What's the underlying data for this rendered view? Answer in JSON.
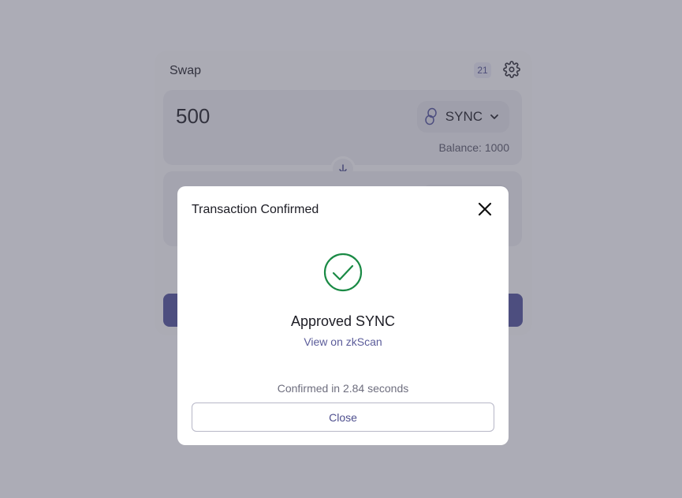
{
  "swap": {
    "title": "Swap",
    "pending_count": "21",
    "from": {
      "amount": "500",
      "token": "SYNC",
      "balance": "Balance: 1000"
    }
  },
  "modal": {
    "title": "Transaction Confirmed",
    "status": "Approved SYNC",
    "explorer_link": "View on zkScan",
    "confirmed_time": "Confirmed in 2.84 seconds",
    "close_label": "Close"
  },
  "colors": {
    "accent": "#4e4f9a",
    "success": "#1a8a45",
    "link": "#5b5c9a"
  },
  "icons": {
    "settings": "gear-icon",
    "token": "sync-token-icon",
    "dropdown": "chevron-down-icon",
    "swap_direction": "arrow-down-icon",
    "close": "close-icon",
    "success": "check-circle-icon"
  }
}
